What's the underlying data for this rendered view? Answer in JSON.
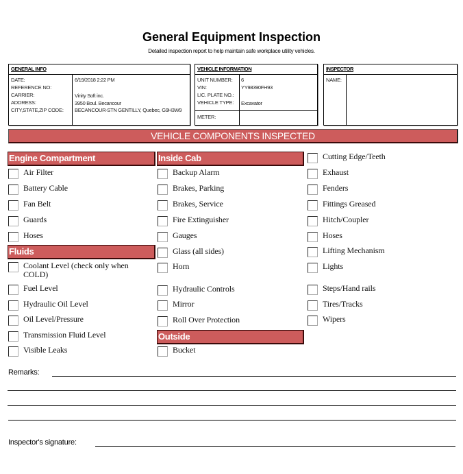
{
  "header": {
    "title": "General Equipment Inspection",
    "subtitle": "Detailed inspection report to help maintain safe workplace utility vehicles."
  },
  "general_info": {
    "heading": "GENERAL INFO",
    "fields": [
      {
        "label": "DATE:",
        "value": "6/19/2018 2:22 PM"
      },
      {
        "label": "REFERENCE NO:",
        "value": ""
      },
      {
        "label": "CARRIER:",
        "value": "Vinity Soft inc."
      },
      {
        "label": "ADDRESS:",
        "value": "3950 Boul. Becancour"
      },
      {
        "label": "CITY,STATE,ZIP CODE:",
        "value": "BECANCOUR-STN GENTILLY, Quebec, G9H3W9"
      }
    ]
  },
  "vehicle_info": {
    "heading": "VEHICLE INFORMATION",
    "fields": [
      {
        "label": "UNIT NUMBER:",
        "value": "6"
      },
      {
        "label": "VIN:",
        "value": "YY98390FH93"
      },
      {
        "label": "LIC. PLATE NO.:",
        "value": ""
      },
      {
        "label": "VEHICLE TYPE:",
        "value": "Excavator"
      }
    ],
    "meter": {
      "label": "METER:",
      "value": ""
    }
  },
  "inspector": {
    "heading": "INSPECTOR",
    "name_label": "NAME:",
    "name_value": ""
  },
  "components": {
    "banner": "VEHICLE COMPONENTS INSPECTED",
    "colors": {
      "section_bg": "#cd5c5c",
      "section_text": "#ffffff"
    },
    "engine": {
      "title": "Engine Compartment",
      "items": [
        "Air Filter",
        "Battery Cable",
        "Fan Belt",
        "Guards",
        "Hoses"
      ]
    },
    "fluids": {
      "title": "Fluids",
      "items": [
        "Coolant Level (check only when COLD)",
        "Fuel Level",
        "Hydraulic Oil Level",
        "Oil Level/Pressure",
        "Transmission Fluid Level",
        "Visible Leaks"
      ]
    },
    "inside_cab": {
      "title": "Inside Cab",
      "items": [
        "Backup Alarm",
        "Brakes, Parking",
        "Brakes, Service",
        "Fire Extinguisher",
        "Gauges",
        "Glass (all sides)",
        "Horn",
        "Hydraulic Controls",
        "Mirror",
        "Roll Over Protection"
      ]
    },
    "outside": {
      "title": "Outside",
      "items": [
        "Bucket"
      ]
    },
    "other": {
      "items": [
        "Cutting Edge/Teeth",
        "Exhaust",
        "Fenders",
        "Fittings Greased",
        "Hitch/Coupler",
        "Hoses",
        "Lifting Mechanism",
        "Lights",
        "Steps/Hand rails",
        "Tires/Tracks",
        "Wipers"
      ]
    }
  },
  "footer": {
    "remarks_label": "Remarks:",
    "signature_label": "Inspector's signature:"
  }
}
